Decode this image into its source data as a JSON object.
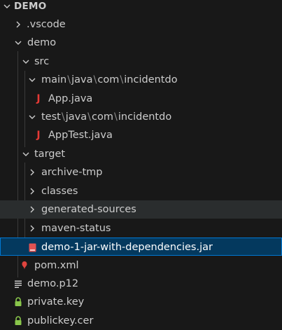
{
  "explorer": {
    "root_label": "DEMO",
    "items": [
      {
        "label": ".vscode"
      },
      {
        "label": "demo"
      },
      {
        "label": "src"
      },
      {
        "parts": [
          "main",
          "java",
          "com",
          "incidentdo"
        ],
        "sep": "\\"
      },
      {
        "label": "App.java"
      },
      {
        "parts": [
          "test",
          "java",
          "com",
          "incidentdo"
        ],
        "sep": "\\"
      },
      {
        "label": "AppTest.java"
      },
      {
        "label": "target"
      },
      {
        "label": "archive-tmp"
      },
      {
        "label": "classes"
      },
      {
        "label": "generated-sources"
      },
      {
        "label": "maven-status"
      },
      {
        "label": "demo-1-jar-with-dependencies.jar"
      },
      {
        "label": "pom.xml"
      },
      {
        "label": "demo.p12"
      },
      {
        "label": "private.key"
      },
      {
        "label": "publickey.cer"
      }
    ]
  },
  "colors": {
    "background": "#181818",
    "selected_bg": "#04395e",
    "selected_border": "#0078d4",
    "hover_bg": "#2a2d2e",
    "java_icon": "#e53935",
    "jar_icon": "#e05252",
    "maven_icon": "#e0443e",
    "key_icon": "#89c64b"
  },
  "icons": {
    "folder_open": "chevron-down-icon",
    "folder_closed": "chevron-right-icon",
    "java": "java-file-icon",
    "jar": "jar-file-icon",
    "maven": "maven-pom-icon",
    "p12": "certificate-lines-icon",
    "key": "lock-icon"
  }
}
